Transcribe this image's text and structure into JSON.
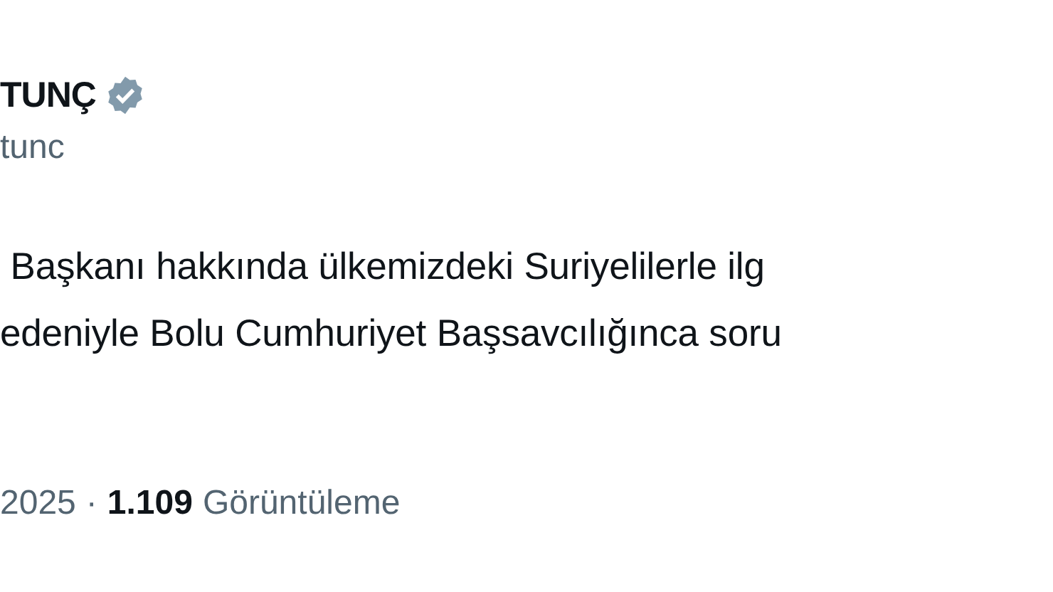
{
  "author": {
    "name": "TUNÇ",
    "verified": true,
    "handle": "tunc"
  },
  "text_lines": [
    " Başkanı hakkında ülkemizdeki Suriyelilerle ilg",
    "edeniyle Bolu Cumhuriyet Başsavcılığınca soru"
  ],
  "meta": {
    "date": "2025",
    "separator": "·",
    "views_count": "1.109",
    "views_label": "Görüntüleme"
  }
}
